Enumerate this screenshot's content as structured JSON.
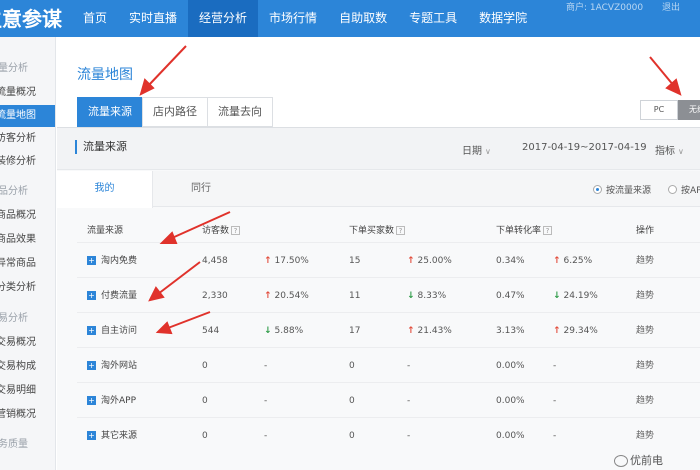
{
  "app": {
    "brand": "生意参谋",
    "user_text": "商户: 1ACVZ0000",
    "user_text2": "退出"
  },
  "nav": {
    "items": [
      {
        "label": "首页"
      },
      {
        "label": "实时直播"
      },
      {
        "label": "经营分析"
      },
      {
        "label": "市场行情"
      },
      {
        "label": "自助取数"
      },
      {
        "label": "专题工具"
      },
      {
        "label": "数据学院"
      }
    ],
    "active_index": 2
  },
  "sidebar": {
    "groups": [
      {
        "label": "流量分析"
      },
      {
        "label": "商品分析"
      },
      {
        "label": "交易分析"
      },
      {
        "label": "服务质量"
      }
    ],
    "items": [
      {
        "label": "流量概况"
      },
      {
        "label": "流量地图"
      },
      {
        "label": "访客分析"
      },
      {
        "label": "装修分析"
      },
      {
        "label": "商品概况"
      },
      {
        "label": "商品效果"
      },
      {
        "label": "异常商品"
      },
      {
        "label": "分类分析"
      },
      {
        "label": "交易概况"
      },
      {
        "label": "交易构成"
      },
      {
        "label": "交易明细"
      },
      {
        "label": "营销概况"
      }
    ]
  },
  "main": {
    "title": "流量地图",
    "tabs": [
      {
        "label": "流量来源"
      },
      {
        "label": "店内路径"
      },
      {
        "label": "流量去向"
      }
    ],
    "device": {
      "pc": "PC",
      "wireless": "无线"
    }
  },
  "section": {
    "title": "流量来源",
    "date_label": "日期",
    "date_range": "2017-04-19~2017-04-19",
    "indicator_label": "指标",
    "subtabs": [
      {
        "label": "我的"
      },
      {
        "label": "同行"
      }
    ],
    "radio_source": "按流量来源",
    "radio_app": "按APP"
  },
  "table": {
    "headers": {
      "source": "流量来源",
      "visitors": "访客数",
      "buyers": "下单买家数",
      "conversion": "下单转化率",
      "action": "操作"
    },
    "rows": [
      {
        "source": "淘内免费",
        "visitors": "4,458",
        "v_dir": "up",
        "v_change": "17.50%",
        "buyers": "15",
        "b_dir": "up",
        "b_change": "25.00%",
        "conv": "0.34%",
        "c_dir": "up",
        "c_change": "6.25%",
        "action": "趋势"
      },
      {
        "source": "付费流量",
        "visitors": "2,330",
        "v_dir": "up",
        "v_change": "20.54%",
        "buyers": "11",
        "b_dir": "down",
        "b_change": "8.33%",
        "conv": "0.47%",
        "c_dir": "down",
        "c_change": "24.19%",
        "action": "趋势"
      },
      {
        "source": "自主访问",
        "visitors": "544",
        "v_dir": "down",
        "v_change": "5.88%",
        "buyers": "17",
        "b_dir": "up",
        "b_change": "21.43%",
        "conv": "3.13%",
        "c_dir": "up",
        "c_change": "29.34%",
        "action": "趋势"
      },
      {
        "source": "淘外网站",
        "visitors": "0",
        "v_dir": "",
        "v_change": "-",
        "buyers": "0",
        "b_dir": "",
        "b_change": "-",
        "conv": "0.00%",
        "c_dir": "",
        "c_change": "-",
        "action": "趋势"
      },
      {
        "source": "淘外APP",
        "visitors": "0",
        "v_dir": "",
        "v_change": "-",
        "buyers": "0",
        "b_dir": "",
        "b_change": "-",
        "conv": "0.00%",
        "c_dir": "",
        "c_change": "-",
        "action": "趋势"
      },
      {
        "source": "其它来源",
        "visitors": "0",
        "v_dir": "",
        "v_change": "-",
        "buyers": "0",
        "b_dir": "",
        "b_change": "-",
        "conv": "0.00%",
        "c_dir": "",
        "c_change": "-",
        "action": "趋势"
      }
    ]
  },
  "colors": {
    "primary": "#2c85d8",
    "up": "#e24c3b",
    "down": "#2e9b47",
    "annotation": "#e0322b"
  },
  "watermark": "优前电"
}
